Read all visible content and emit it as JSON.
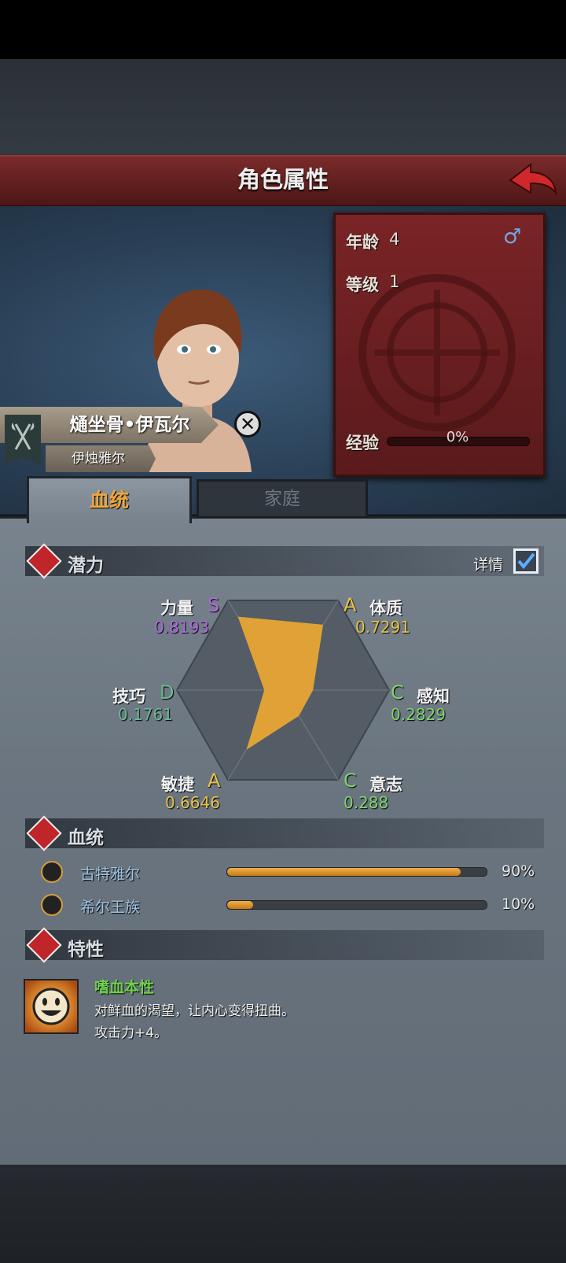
{
  "header": {
    "title": "角色属性"
  },
  "character": {
    "age_label": "年龄",
    "age_value": "4",
    "level_label": "等级",
    "level_value": "1",
    "gender_symbol": "♂",
    "exp_label": "经验",
    "exp_value": "0%",
    "exp_fraction": 0,
    "name": "熥坐骨•伊瓦尔",
    "clan": "伊烛雅尔"
  },
  "tabs": [
    {
      "label": "血统",
      "active": true
    },
    {
      "label": "家庭",
      "active": false
    }
  ],
  "potential": {
    "title": "潜力",
    "detail_label": "详情",
    "detail_checked": true,
    "stats": [
      {
        "name": "力量",
        "grade": "S",
        "value": "0.8193",
        "color": "#b06ae0"
      },
      {
        "name": "体质",
        "grade": "A",
        "value": "0.7291",
        "color": "#e6c34a"
      },
      {
        "name": "感知",
        "grade": "C",
        "value": "0.2829",
        "color": "#7ed46a"
      },
      {
        "name": "意志",
        "grade": "C",
        "value": "0.288",
        "color": "#7ed46a"
      },
      {
        "name": "敏捷",
        "grade": "A",
        "value": "0.6646",
        "color": "#e6c34a"
      },
      {
        "name": "技巧",
        "grade": "D",
        "value": "0.1761",
        "color": "#6ab890"
      }
    ]
  },
  "bloodline": {
    "title": "血统",
    "items": [
      {
        "name": "古特雅尔",
        "percent": "90%",
        "fraction": 0.9
      },
      {
        "name": "希尔王族",
        "percent": "10%",
        "fraction": 0.1
      }
    ]
  },
  "traits": {
    "title": "特性",
    "items": [
      {
        "name": "嗜血本性",
        "line1": "对鲜血的渴望，让内心变得扭曲。",
        "line2": "攻击力+4。"
      }
    ]
  },
  "colors": {
    "accent_orange": "#f0a53c",
    "banner_red": "#7a2426",
    "radar_fill": "#e0a236"
  }
}
